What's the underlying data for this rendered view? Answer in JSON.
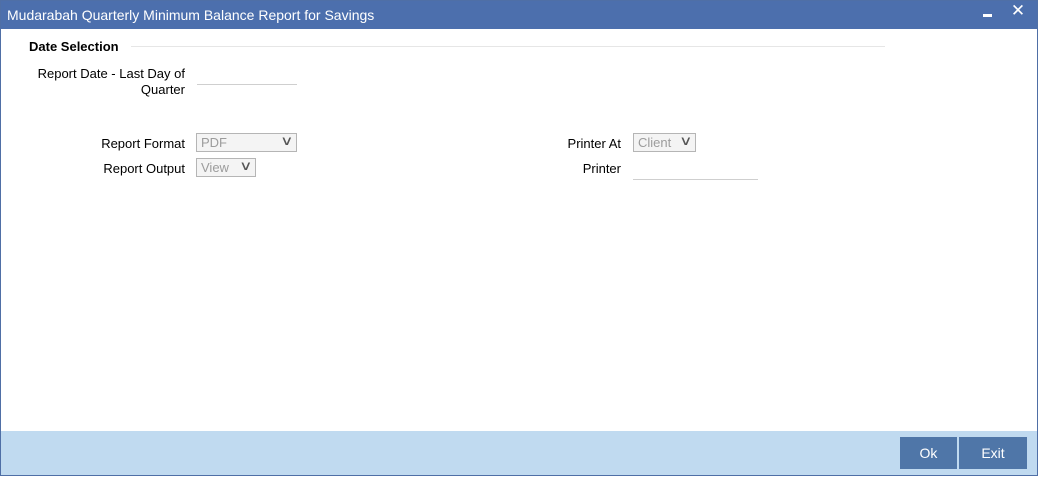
{
  "window": {
    "title": "Mudarabah Quarterly Minimum Balance Report for Savings",
    "minimize_icon": "minimize-icon",
    "close_icon": "close-icon",
    "close_glyph": "✕"
  },
  "date_selection": {
    "section_title": "Date Selection",
    "report_date_label_line1": "Report Date - Last Day of",
    "report_date_label_line2": "Quarter",
    "report_date_value": ""
  },
  "report": {
    "format_label": "Report Format",
    "format_value": "PDF",
    "output_label": "Report Output",
    "output_value": "View",
    "printer_at_label": "Printer At",
    "printer_at_value": "Client",
    "printer_label": "Printer",
    "printer_value": ""
  },
  "footer": {
    "ok_label": "Ok",
    "exit_label": "Exit"
  },
  "colors": {
    "titlebar": "#4c6fad",
    "footer": "#c0daf0",
    "button": "#4f76a8"
  }
}
